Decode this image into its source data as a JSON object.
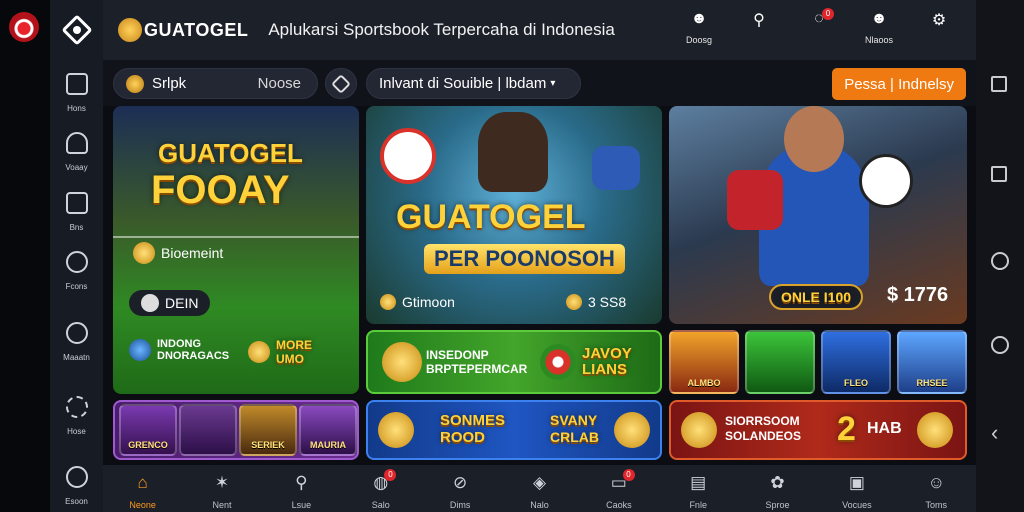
{
  "brand": {
    "name": "GUATOGEL",
    "tagline": "Aplukarsi Sportsbook Terpercaha di Indonesia"
  },
  "header_icons": [
    {
      "icon": "person-icon",
      "glyph": "☻",
      "label": "Doosg",
      "badge": ""
    },
    {
      "icon": "search-icon",
      "glyph": "⚲",
      "label": "",
      "badge": ""
    },
    {
      "icon": "chat-icon",
      "glyph": "◌",
      "label": "",
      "badge": "0"
    },
    {
      "icon": "user-group-icon",
      "glyph": "☻",
      "label": "Nlaoos",
      "badge": ""
    },
    {
      "icon": "settings-icon",
      "glyph": "⚙",
      "label": "",
      "badge": ""
    }
  ],
  "left_nav": [
    {
      "icon": "bar-chart-icon",
      "label": "Hons"
    },
    {
      "icon": "trophy-icon",
      "label": "Voaay"
    },
    {
      "icon": "ticket-icon",
      "label": "Bns"
    },
    {
      "icon": "ball-icon",
      "label": "Fcons"
    },
    {
      "icon": "gauge-icon",
      "label": "Maaatn"
    },
    {
      "icon": "gear-icon",
      "label": "Hose"
    },
    {
      "icon": "circle-icon",
      "label": "Esoon"
    }
  ],
  "filter": {
    "search_label": "Srlpk",
    "search_value": "Noose",
    "dropdown_label": "Inlvant di Souible | lbdam",
    "cta_label": "Pessa | Indnelsy"
  },
  "banners": {
    "left": {
      "title_line1": "GUATOGEL",
      "title_line2": "FOOAY",
      "chip1": "Bioemeint",
      "chip2": "DEIN",
      "promo_a": "INDONG DNORAGACS",
      "promo_b": "MORE UMO"
    },
    "center": {
      "title_line1": "GUATOGEL",
      "title_line2": "PER POONOSOH",
      "stat1": "Gtimoon",
      "stat2": "3 SS8"
    },
    "right": {
      "button": "ONLE I100",
      "amount": "$ 1776"
    }
  },
  "promos": {
    "center_mid": {
      "text_a": "INSEDONP BRPTEPERMCAR",
      "text_b": "JAVOY LIANS"
    },
    "left_bottom_games": [
      "GRENCO",
      "",
      "SERIEK",
      "MAURIA"
    ],
    "center_bottom": {
      "text_a": "SONMES ROOD",
      "text_b": "SVANY CRLAB"
    },
    "right_bottom": {
      "text_a": "SIORRSOOM SOLANDEOS",
      "text_b": "HAB"
    },
    "right_games": [
      "ALMBO",
      "",
      "FLEO",
      "RHSEE"
    ]
  },
  "bottom_nav": [
    {
      "icon": "home-icon",
      "glyph": "⌂",
      "label": "Neone",
      "active": true,
      "badge": ""
    },
    {
      "icon": "soccer-icon",
      "glyph": "✶",
      "label": "Nent",
      "active": false,
      "badge": ""
    },
    {
      "icon": "search-icon",
      "glyph": "⚲",
      "label": "Lsue",
      "active": false,
      "badge": ""
    },
    {
      "icon": "chat-icon",
      "glyph": "◍",
      "label": "Salo",
      "active": false,
      "badge": "0"
    },
    {
      "icon": "compass-icon",
      "glyph": "⊘",
      "label": "Dims",
      "active": false,
      "badge": ""
    },
    {
      "icon": "pin-icon",
      "glyph": "◈",
      "label": "Nalo",
      "active": false,
      "badge": ""
    },
    {
      "icon": "card-icon",
      "glyph": "▭",
      "label": "Caoks",
      "active": false,
      "badge": "0"
    },
    {
      "icon": "document-icon",
      "glyph": "▤",
      "label": "Fnle",
      "active": false,
      "badge": ""
    },
    {
      "icon": "gift-icon",
      "glyph": "✿",
      "label": "Sproe",
      "active": false,
      "badge": ""
    },
    {
      "icon": "chart-icon",
      "glyph": "▣",
      "label": "Vocues",
      "active": false,
      "badge": ""
    },
    {
      "icon": "user-icon",
      "glyph": "☺",
      "label": "Toms",
      "active": false,
      "badge": ""
    }
  ],
  "colors": {
    "accent": "#f07a12",
    "active": "#ff9a1e",
    "badge": "#e0262d"
  }
}
